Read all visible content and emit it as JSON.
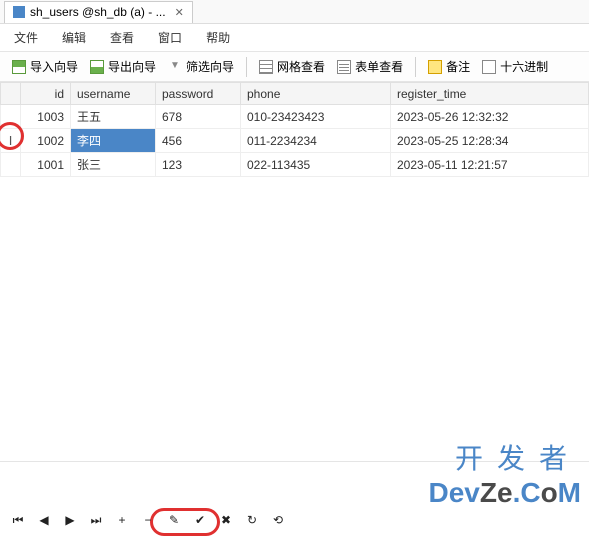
{
  "tab": {
    "title": "sh_users @sh_db (a) - ...",
    "close": "✕"
  },
  "menu": {
    "file": "文件",
    "edit": "编辑",
    "view": "查看",
    "window": "窗口",
    "help": "帮助"
  },
  "toolbar": {
    "import_wizard": "导入向导",
    "export_wizard": "导出向导",
    "filter_wizard": "筛选向导",
    "grid_view": "网格查看",
    "form_view": "表单查看",
    "notes": "备注",
    "hex": "十六进制"
  },
  "table": {
    "headers": {
      "id": "id",
      "username": "username",
      "password": "password",
      "phone": "phone",
      "register_time": "register_time"
    },
    "rows": [
      {
        "id": "1003",
        "username": "王五",
        "password": "678",
        "phone": "010-23423423",
        "register_time": "2023-05-26 12:32:32",
        "current": false,
        "selected": false
      },
      {
        "id": "1002",
        "username": "李四",
        "password": "456",
        "phone": "011-2234234",
        "register_time": "2023-05-25 12:28:34",
        "current": true,
        "selected": true
      },
      {
        "id": "1001",
        "username": "张三",
        "password": "123",
        "phone": "022-113435",
        "register_time": "2023-05-11 12:21:57",
        "current": false,
        "selected": false
      }
    ]
  },
  "watermark": {
    "line1": "开发者",
    "devze1": "Dev",
    "devze2": "Ze",
    "devze3": ".C",
    "devze4": "o",
    "devze5": "M"
  },
  "nav": {
    "first": "⏮",
    "prev": "◀",
    "next": "▶",
    "last": "⏭",
    "plus": "+",
    "minus": "−",
    "edit": "✎",
    "check": "✔",
    "cancel": "✖",
    "refresh": "↻",
    "undo": "⟲"
  }
}
